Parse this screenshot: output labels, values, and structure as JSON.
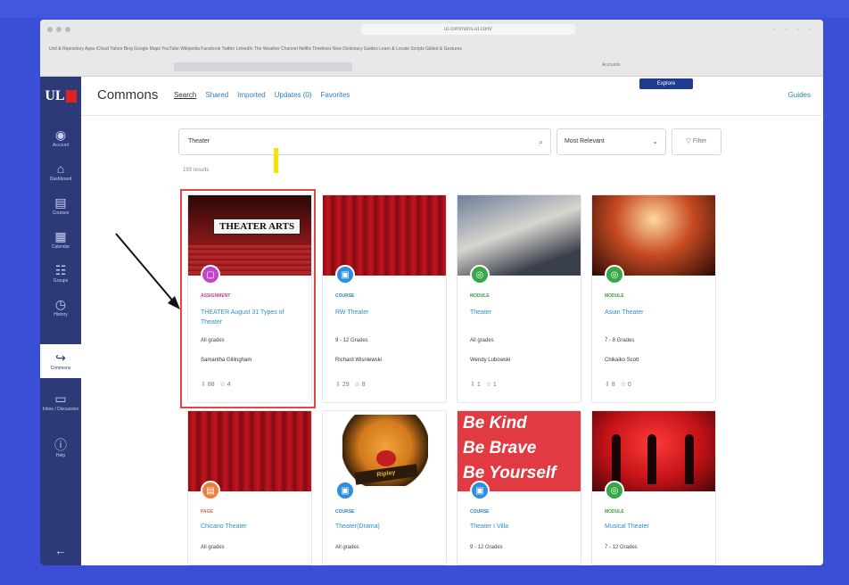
{
  "browser": {
    "address": "ul.commons.ut.com/",
    "bookmarks": "Unit & Repository   Apps   iCloud   Yahoo   Bing   Google Maps   YouTube   Wikipedia   Facebook   Twitter   LinkedIn   The Weather Channel   Netflix   Timelines   New Dictionary   Guides   Learn & Locate   Scripts   Gilded & Gestures",
    "extra_tab": "Accounts"
  },
  "sidebar": {
    "logo": "UL",
    "items": [
      {
        "label": "Account",
        "icon": "user-circle-icon"
      },
      {
        "label": "Dashboard",
        "icon": "dashboard-icon"
      },
      {
        "label": "Courses",
        "icon": "courses-icon"
      },
      {
        "label": "Calendar",
        "icon": "calendar-icon"
      },
      {
        "label": "Groups",
        "icon": "groups-icon"
      },
      {
        "label": "History",
        "icon": "history-icon"
      },
      {
        "label": "Commons",
        "icon": "commons-icon"
      },
      {
        "label": "Inbox / Discussion",
        "icon": "inbox-icon"
      },
      {
        "label": "Help",
        "icon": "help-icon"
      }
    ],
    "collapse_glyph": "←"
  },
  "header": {
    "title": "Commons",
    "tabs": [
      "Search",
      "Shared",
      "Imported",
      "Updates (0)",
      "Favorites"
    ],
    "explore_label": "Explore",
    "guides_label": "Guides"
  },
  "search": {
    "value": "Theater",
    "sort_value": "Most Relevant",
    "filter_label": "Filter",
    "results_text": "193 results"
  },
  "cards": [
    {
      "category": "ASSIGNMENT",
      "category_color": "#c2379a",
      "badge_color": "#c244c9",
      "title": "THEATER August 31 Types of Theater",
      "grade": "All grades",
      "author": "Samantha Gillingham",
      "downloads": "88",
      "favorites": "4",
      "image_text": "THEATER ARTS"
    },
    {
      "category": "COURSE",
      "category_color": "#2d7fc1",
      "badge_color": "#2d8fe0",
      "title": "RW Theater",
      "grade": "9 - 12 Grades",
      "author": "Richard Wisniewski",
      "downloads": "29",
      "favorites": "8"
    },
    {
      "category": "MODULE",
      "category_color": "#3b9b3b",
      "badge_color": "#37a846",
      "title": "Theater",
      "grade": "All grades",
      "author": "Wendy Lubowski",
      "downloads": "1",
      "favorites": "1"
    },
    {
      "category": "MODULE",
      "category_color": "#3b9b3b",
      "badge_color": "#37a846",
      "title": "Asian Theater",
      "grade": "7 - 8 Grades",
      "author": "Chikaiko Scott",
      "downloads": "8",
      "favorites": "0"
    },
    {
      "category": "PAGE",
      "category_color": "#e0673a",
      "badge_color": "#ef7f3c",
      "title": "Chicano Theater",
      "grade": "All grades"
    },
    {
      "category": "COURSE",
      "category_color": "#2d7fc1",
      "badge_color": "#2d8fe0",
      "title": "Theater(Drama)",
      "grade": "All grades",
      "image_text": "Ripley"
    },
    {
      "category": "COURSE",
      "category_color": "#2d7fc1",
      "badge_color": "#2d8fe0",
      "title": "Theater I Villa",
      "grade": "9 - 12 Grades",
      "image_text": "Be Kind\nBe Brave\nBe Yourself"
    },
    {
      "category": "MODULE",
      "category_color": "#3b9b3b",
      "badge_color": "#37a846",
      "title": "Musical Theater",
      "grade": "7 - 12 Grades"
    }
  ]
}
